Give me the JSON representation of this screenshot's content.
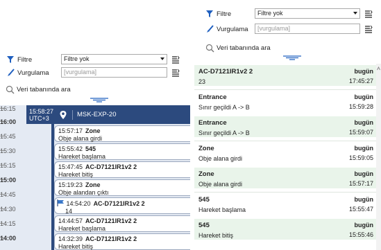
{
  "left_panel": {
    "filter_label": "Filtre",
    "filter_value": "Filtre yok",
    "highlight_label": "Vurgulama",
    "highlight_placeholder": "[vurgulama]",
    "search_label": "Veri tabanında ara"
  },
  "right_panel": {
    "filter_label": "Filtre",
    "filter_value": "Filtre yok",
    "highlight_label": "Vurgulama",
    "highlight_placeholder": "[vurgulama]",
    "search_label": "Veri tabanında ara"
  },
  "timeline": {
    "ticks": [
      "16:15",
      "16:00",
      "15:45",
      "15:30",
      "15:15",
      "15:00",
      "14:45",
      "14:30",
      "14:15",
      "14:00"
    ],
    "header": {
      "time": "15:58:27",
      "timezone": "UTC+3",
      "title": "MSK-EXP-20"
    },
    "events": [
      {
        "time": "15:57:17",
        "title": "Zone",
        "desc": "Obje alana girdi"
      },
      {
        "time": "15:55:42",
        "title": "545",
        "desc": "Hareket başlama"
      },
      {
        "time": "15:47:45",
        "title": "AC-D7121IR1v2 2",
        "desc": "Hareket bitiş"
      },
      {
        "time": "15:19:23",
        "title": "Zone",
        "desc": "Obje alandan çıktı"
      },
      {
        "time": "14:54:20",
        "title": "AC-D7121IR1v2 2",
        "desc": "14"
      },
      {
        "time": "14:44:57",
        "title": "AC-D7121IR1v2 2",
        "desc": "Hareket başlama"
      },
      {
        "time": "14:32:39",
        "title": "AC-D7121IR1v2 2",
        "desc": "Hareket bitiş"
      }
    ]
  },
  "list": {
    "items": [
      {
        "title": "AC-D7121IR1v2 2",
        "desc": "23",
        "day": "bugün",
        "time": "17:45:27"
      },
      {
        "title": "Entrance",
        "desc": "Sınır geçildi A -> B",
        "day": "bugün",
        "time": "15:59:28"
      },
      {
        "title": "Entrance",
        "desc": "Sınır geçildi A -> B",
        "day": "bugün",
        "time": "15:59:07"
      },
      {
        "title": "Zone",
        "desc": "Obje alana girdi",
        "day": "bugün",
        "time": "15:59:05"
      },
      {
        "title": "Zone",
        "desc": "Obje alana girdi",
        "day": "bugün",
        "time": "15:57:17"
      },
      {
        "title": "545",
        "desc": "Hareket başlama",
        "day": "bugün",
        "time": "15:55:47"
      },
      {
        "title": "545",
        "desc": "Hareket bitiş",
        "day": "bugün",
        "time": "15:55:46"
      }
    ]
  },
  "colors": {
    "header_bg": "#2c4a7e",
    "timeline_bg": "#e4eaf3",
    "list_alt_bg": "#e9f4ea",
    "accent_blue": "#1f5fbf"
  }
}
